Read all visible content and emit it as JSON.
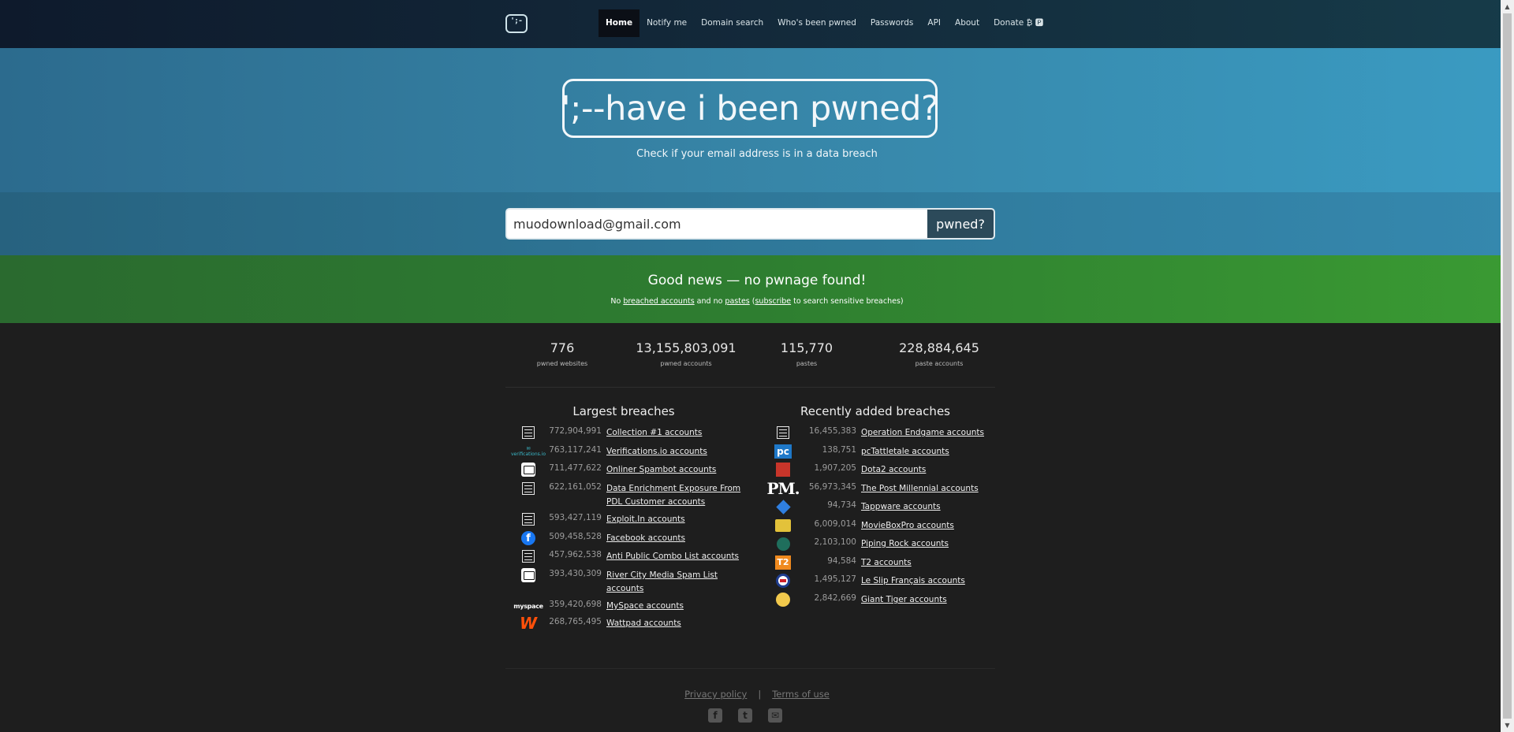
{
  "logo": {
    "glyph": "';-"
  },
  "nav": {
    "items": [
      "Home",
      "Notify me",
      "Domain search",
      "Who's been pwned",
      "Passwords",
      "API",
      "About",
      "Donate ₿ 🅿"
    ]
  },
  "hero": {
    "title": "';--have i been pwned?",
    "tagline": "Check if your email address is in a data breach"
  },
  "search": {
    "value": "muodownload@gmail.com",
    "button": "pwned?"
  },
  "result": {
    "heading": "Good news — no pwnage found!",
    "p1": "No ",
    "link1": "breached accounts",
    "p2": " and no ",
    "link2": "pastes",
    "p3": " (",
    "link3": "subscribe",
    "p4": " to search sensitive breaches)"
  },
  "stats": [
    {
      "num": "776",
      "label": "pwned websites"
    },
    {
      "num": "13,155,803,091",
      "label": "pwned accounts"
    },
    {
      "num": "115,770",
      "label": "pastes"
    },
    {
      "num": "228,884,645",
      "label": "paste accounts"
    }
  ],
  "largest": {
    "title": "Largest breaches",
    "rows": [
      {
        "icon": "doc",
        "count": "772,904,991",
        "name": "Collection #1 accounts"
      },
      {
        "icon": "verifications",
        "count": "763,117,241",
        "name": "Verifications.io accounts"
      },
      {
        "icon": "envelope",
        "count": "711,477,622",
        "name": "Onliner Spambot accounts"
      },
      {
        "icon": "doc",
        "count": "622,161,052",
        "name": "Data Enrichment Exposure From PDL Customer accounts"
      },
      {
        "icon": "doc",
        "count": "593,427,119",
        "name": "Exploit.In accounts"
      },
      {
        "icon": "facebook",
        "count": "509,458,528",
        "name": "Facebook accounts"
      },
      {
        "icon": "doc",
        "count": "457,962,538",
        "name": "Anti Public Combo List accounts"
      },
      {
        "icon": "envelope",
        "count": "393,430,309",
        "name": "River City Media Spam List accounts"
      },
      {
        "icon": "myspace",
        "count": "359,420,698",
        "name": "MySpace accounts"
      },
      {
        "icon": "wattpad",
        "count": "268,765,495",
        "name": "Wattpad accounts"
      }
    ]
  },
  "recent": {
    "title": "Recently added breaches",
    "rows": [
      {
        "icon": "doc",
        "count": "16,455,383",
        "name": "Operation Endgame accounts"
      },
      {
        "icon": "pc",
        "count": "138,751",
        "name": "pcTattletale accounts"
      },
      {
        "icon": "dota",
        "count": "1,907,205",
        "name": "Dota2 accounts"
      },
      {
        "icon": "pm",
        "count": "56,973,345",
        "name": "The Post Millennial accounts"
      },
      {
        "icon": "tappware",
        "count": "94,734",
        "name": "Tappware accounts"
      },
      {
        "icon": "moviebox",
        "count": "6,009,014",
        "name": "MovieBoxPro accounts"
      },
      {
        "icon": "pipingrock",
        "count": "2,103,100",
        "name": "Piping Rock accounts"
      },
      {
        "icon": "t2",
        "count": "94,584",
        "name": "T2 accounts"
      },
      {
        "icon": "leslip",
        "count": "1,495,127",
        "name": "Le Slip Français accounts"
      },
      {
        "icon": "gianttiger",
        "count": "2,842,669",
        "name": "Giant Tiger accounts"
      }
    ]
  },
  "footer": {
    "privacy": "Privacy policy",
    "separator": "|",
    "terms": "Terms of use"
  },
  "icon_labels": {
    "verifications": "verifications.io",
    "myspace": "myspace",
    "pc": "pc",
    "pm": "PM.",
    "t2": "T2",
    "facebook": "f",
    "wattpad": "W"
  }
}
